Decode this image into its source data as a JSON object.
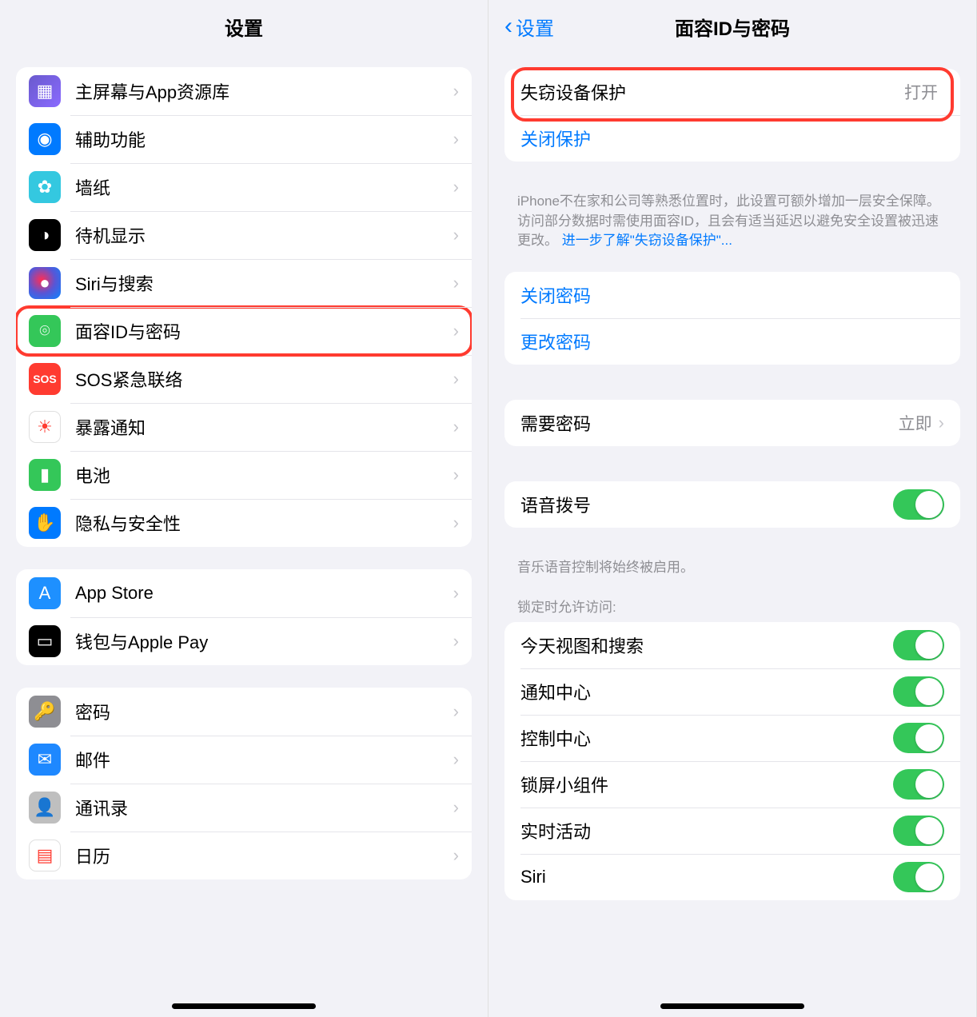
{
  "left": {
    "title": "设置",
    "groups": [
      {
        "rows": [
          {
            "icon": "home-icon",
            "iconClass": "ic-home",
            "label": "主屏幕与App资源库",
            "highlighted": false
          },
          {
            "icon": "accessibility-icon",
            "iconClass": "ic-access",
            "label": "辅助功能",
            "highlighted": false
          },
          {
            "icon": "wallpaper-icon",
            "iconClass": "ic-wall",
            "label": "墙纸",
            "highlighted": false
          },
          {
            "icon": "standby-icon",
            "iconClass": "ic-standby",
            "label": "待机显示",
            "highlighted": false
          },
          {
            "icon": "siri-icon",
            "iconClass": "ic-siri",
            "label": "Siri与搜索",
            "highlighted": false
          },
          {
            "icon": "faceid-icon",
            "iconClass": "ic-faceid",
            "label": "面容ID与密码",
            "highlighted": true
          },
          {
            "icon": "sos-icon",
            "iconClass": "ic-sos",
            "label": "SOS紧急联络",
            "highlighted": false
          },
          {
            "icon": "exposure-icon",
            "iconClass": "ic-exposure",
            "label": "暴露通知",
            "highlighted": false
          },
          {
            "icon": "battery-icon",
            "iconClass": "ic-battery",
            "label": "电池",
            "highlighted": false
          },
          {
            "icon": "privacy-icon",
            "iconClass": "ic-privacy",
            "label": "隐私与安全性",
            "highlighted": false
          }
        ]
      },
      {
        "rows": [
          {
            "icon": "appstore-icon",
            "iconClass": "ic-appstore",
            "label": "App Store",
            "highlighted": false
          },
          {
            "icon": "wallet-icon",
            "iconClass": "ic-wallet",
            "label": "钱包与Apple Pay",
            "highlighted": false
          }
        ]
      },
      {
        "rows": [
          {
            "icon": "passwords-icon",
            "iconClass": "ic-passwords",
            "label": "密码",
            "highlighted": false
          },
          {
            "icon": "mail-icon",
            "iconClass": "ic-mail",
            "label": "邮件",
            "highlighted": false
          },
          {
            "icon": "contacts-icon",
            "iconClass": "ic-contacts",
            "label": "通讯录",
            "highlighted": false
          },
          {
            "icon": "calendar-icon",
            "iconClass": "ic-calendar",
            "label": "日历",
            "highlighted": false
          }
        ]
      }
    ]
  },
  "right": {
    "back": "设置",
    "title": "面容ID与密码",
    "stolen": {
      "label": "失窃设备保护",
      "value": "打开",
      "close_label": "关闭保护",
      "footer_pre": "iPhone不在家和公司等熟悉位置时，此设置可额外增加一层安全保障。访问部分数据时需使用面容ID，且会有适当延迟以避免安全设置被迅速更改。",
      "footer_link": "进一步了解\"失窃设备保护\"..."
    },
    "passcode": {
      "off_label": "关闭密码",
      "change_label": "更改密码"
    },
    "require": {
      "label": "需要密码",
      "value": "立即"
    },
    "voice": {
      "label": "语音拨号",
      "footer": "音乐语音控制将始终被启用。"
    },
    "lock_header": "锁定时允许访问:",
    "lock_items": [
      "今天视图和搜索",
      "通知中心",
      "控制中心",
      "锁屏小组件",
      "实时活动",
      "Siri"
    ]
  }
}
